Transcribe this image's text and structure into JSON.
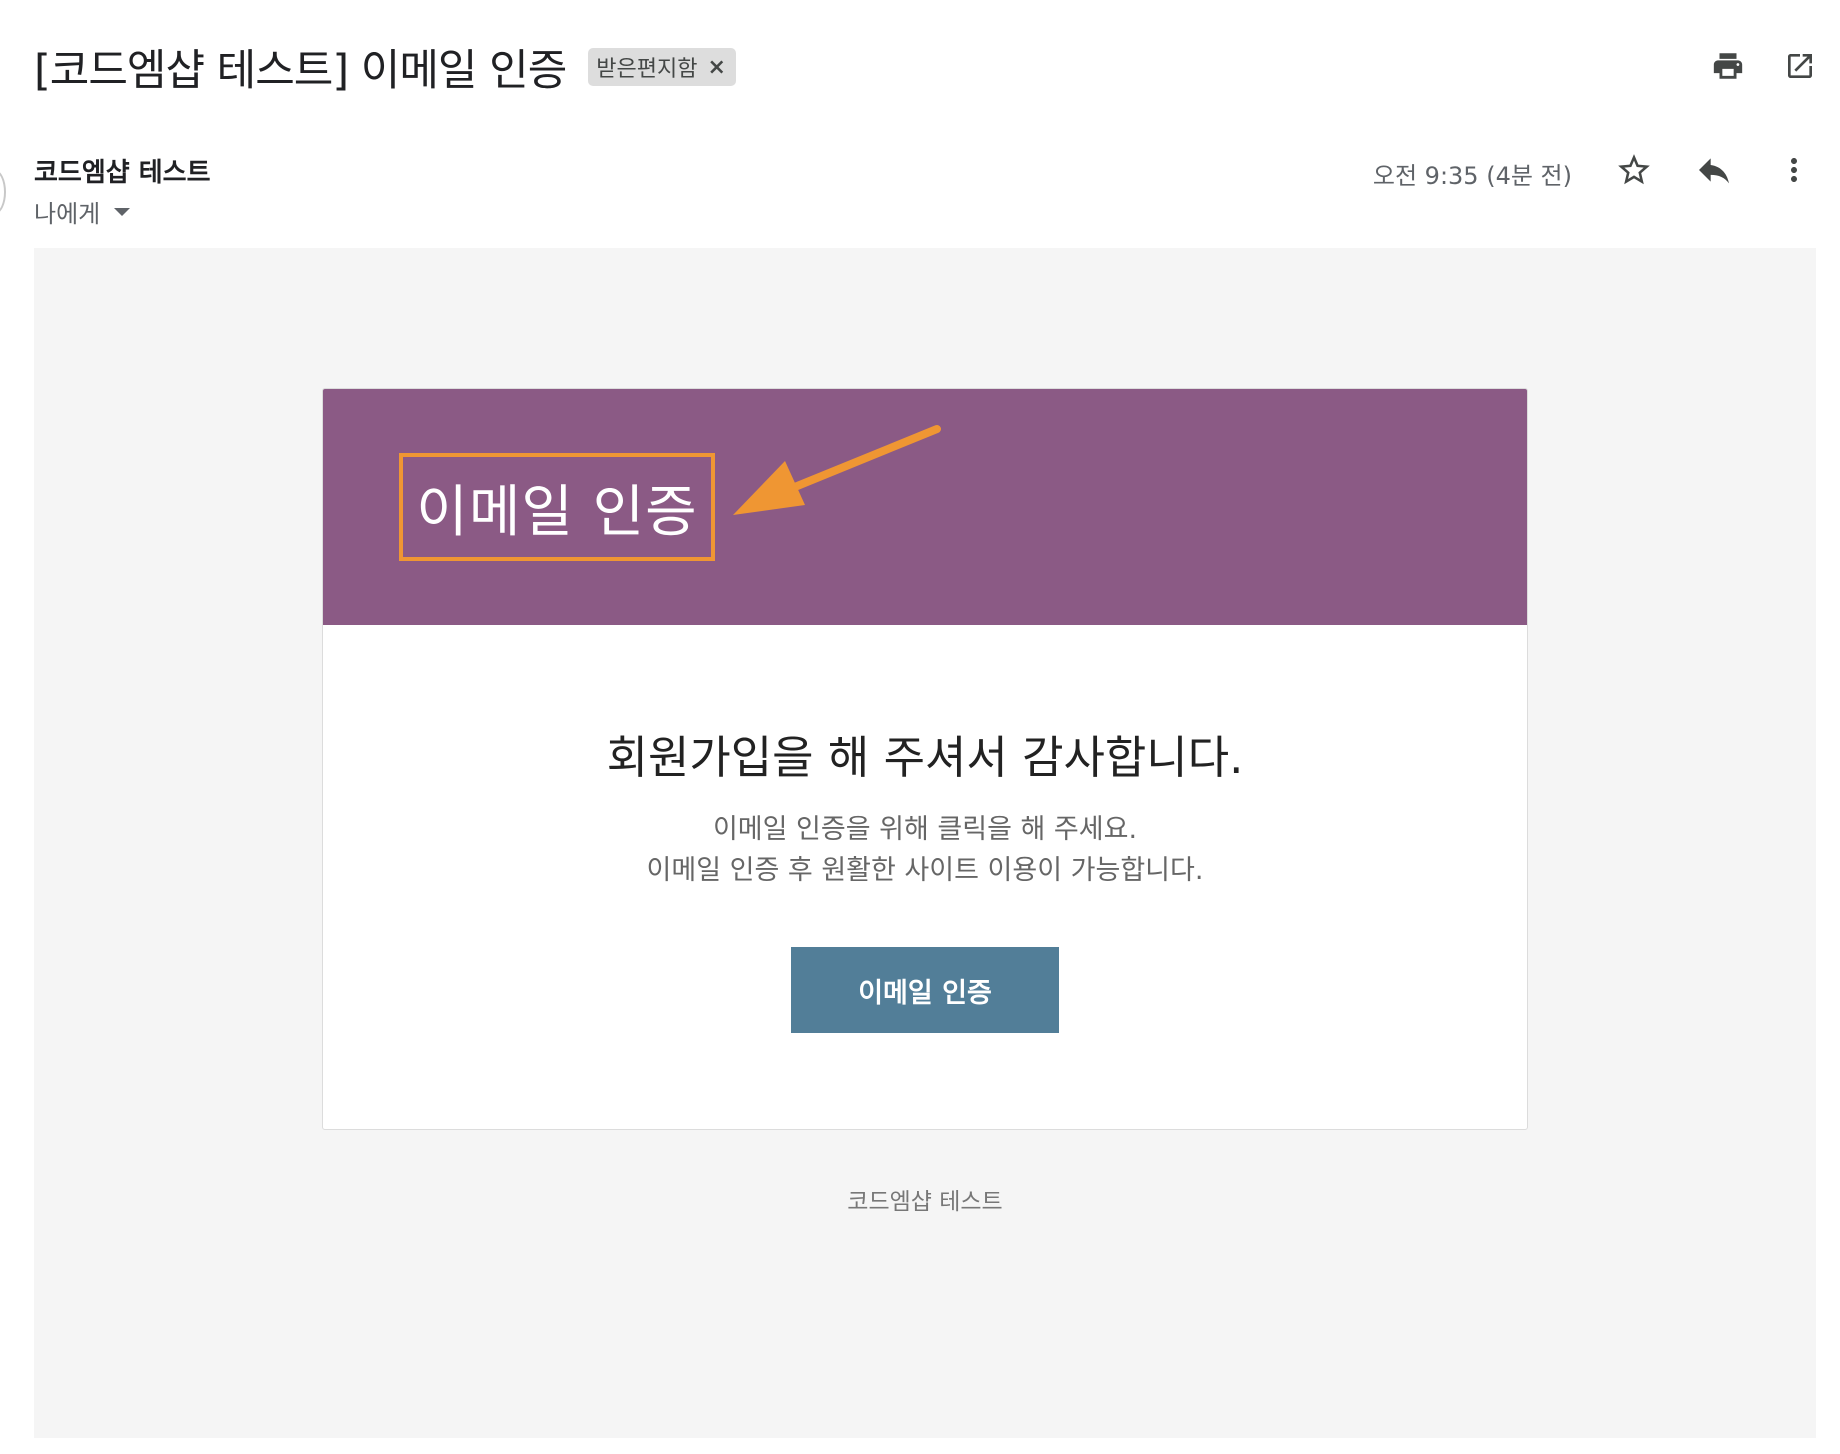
{
  "email": {
    "subject": "[코드엠샵 테스트] 이메일 인증",
    "label_chip": "받은편지함",
    "label_chip_close": "×",
    "sender_name": "코드엠샵 테스트",
    "recipient": "나에게",
    "timestamp": "오전 9:35 (4분 전)"
  },
  "toolbar": {
    "icons": [
      "print-icon",
      "open-in-new-window-icon",
      "star-icon",
      "reply-icon",
      "more-vert-icon"
    ]
  },
  "body": {
    "header_title": "이메일 인증",
    "headline": "회원가입을 해 주셔서 감사합니다.",
    "desc_line1": "이메일 인증을 위해 클릭을 해 주세요.",
    "desc_line2": "이메일 인증 후 원활한 사이트 이용이 가능합니다.",
    "button_label": "이메일 인증",
    "footer": "코드엠샵 테스트"
  },
  "colors": {
    "header_bg": "#8b5a85",
    "annotation": "#ef9633",
    "button_bg": "#527e98",
    "canvas_bg": "#f5f5f5"
  }
}
